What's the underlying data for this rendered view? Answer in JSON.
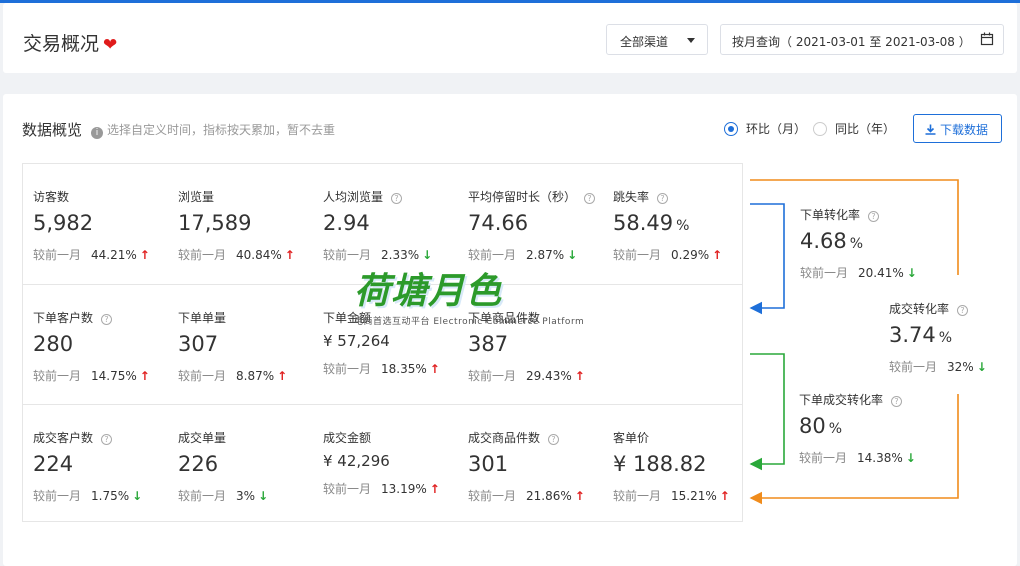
{
  "header": {
    "title": "交易概况",
    "channel_select": "全部渠道",
    "date_query": "按月查询（ 2021-03-01 至 2021-03-08 ）"
  },
  "overview": {
    "title": "数据概览",
    "hint": "选择自定义时间，指标按天累加，暂不去重",
    "radio_mom": "环比（月）",
    "radio_yoy": "同比（年）",
    "download": "下载数据"
  },
  "compare_label": "较前一月",
  "rows": [
    [
      {
        "label": "访客数",
        "value": "5,982",
        "pct": "44.21%",
        "trend": "↑"
      },
      {
        "label": "浏览量",
        "value": "17,589",
        "pct": "40.84%",
        "trend": "↑"
      },
      {
        "label": "人均浏览量",
        "value": "2.94",
        "pct": "2.33%",
        "trend": "↓"
      },
      {
        "label": "平均停留时长（秒）",
        "value": "74.66",
        "pct": "2.87%",
        "trend": "↓"
      },
      {
        "label": "跳失率",
        "value": "58.49",
        "unit": "%",
        "pct": "0.29%",
        "trend": "↑"
      }
    ],
    [
      {
        "label": "下单客户数",
        "value": "280",
        "pct": "14.75%",
        "trend": "↑"
      },
      {
        "label": "下单单量",
        "value": "307",
        "pct": "8.87%",
        "trend": "↑"
      },
      {
        "label": "下单金额",
        "value": "¥ 57,264",
        "pct": "18.35%",
        "trend": "↑"
      },
      {
        "label": "下单商品件数",
        "value": "387",
        "pct": "29.43%",
        "trend": "↑"
      }
    ],
    [
      {
        "label": "成交客户数",
        "value": "224",
        "pct": "1.75%",
        "trend": "↓"
      },
      {
        "label": "成交单量",
        "value": "226",
        "pct": "3%",
        "trend": "↓"
      },
      {
        "label": "成交金额",
        "value": "¥ 42,296",
        "pct": "13.19%",
        "trend": "↑"
      },
      {
        "label": "成交商品件数",
        "value": "301",
        "pct": "21.86%",
        "trend": "↑"
      },
      {
        "label": "客单价",
        "value": "¥ 188.82",
        "pct": "15.21%",
        "trend": "↑"
      }
    ]
  ],
  "conversions": [
    {
      "label": "下单转化率",
      "value": "4.68",
      "unit": "%",
      "pct": "20.41%",
      "trend": "↓"
    },
    {
      "label": "成交转化率",
      "value": "3.74",
      "unit": "%",
      "pct": "32%",
      "trend": "↓"
    },
    {
      "label": "下单成交转化率",
      "value": "80",
      "unit": "%",
      "pct": "14.38%",
      "trend": "↓"
    }
  ],
  "watermark": {
    "big": "荷塘月色",
    "small": "电商首选互动平台 Electronic Commerce Platform"
  },
  "colors": {
    "accent": "#1e6fd9",
    "up": "#e02020",
    "down": "#2aa83a",
    "flow_blue": "#1e6fd9",
    "flow_green": "#2aa83a",
    "flow_orange": "#f08c1c"
  }
}
